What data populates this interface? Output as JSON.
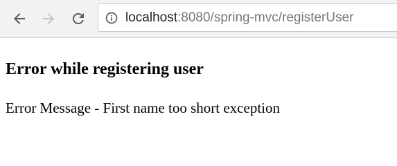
{
  "browser": {
    "back_icon": "arrow-left-icon",
    "forward_icon": "arrow-right-icon",
    "reload_icon": "reload-icon",
    "info_icon": "info-circle-icon",
    "address": {
      "host": "localhost",
      "rest": ":8080/spring-mvc/registerUser"
    },
    "colors": {
      "toolbar": "#f2f2f2",
      "icon_active": "#5a5a5a",
      "icon_disabled": "#c4c4c4"
    }
  },
  "page": {
    "heading": "Error while registering user",
    "message": "Error Message - First name too short exception"
  }
}
